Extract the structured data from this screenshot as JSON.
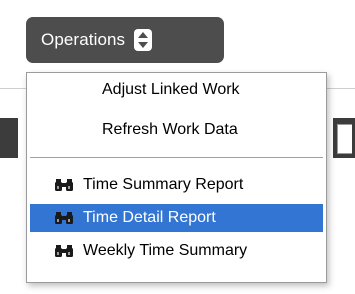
{
  "toolbar": {
    "operations_label": "Operations",
    "operations_icon": "up-down-arrows-icon"
  },
  "menu": {
    "items": [
      {
        "label": "Adjust Linked Work",
        "icon": null,
        "selected": false
      },
      {
        "label": "Refresh Work Data",
        "icon": null,
        "selected": false
      },
      {
        "label": "Time Summary Report",
        "icon": "binoculars-icon",
        "selected": false
      },
      {
        "label": "Time Detail Report",
        "icon": "binoculars-icon",
        "selected": true
      },
      {
        "label": "Weekly Time Summary",
        "icon": "binoculars-icon",
        "selected": false
      }
    ]
  },
  "colors": {
    "button_bg": "#4d4d4d",
    "highlight": "#3275d2",
    "menu_border": "#9b9b9b"
  }
}
